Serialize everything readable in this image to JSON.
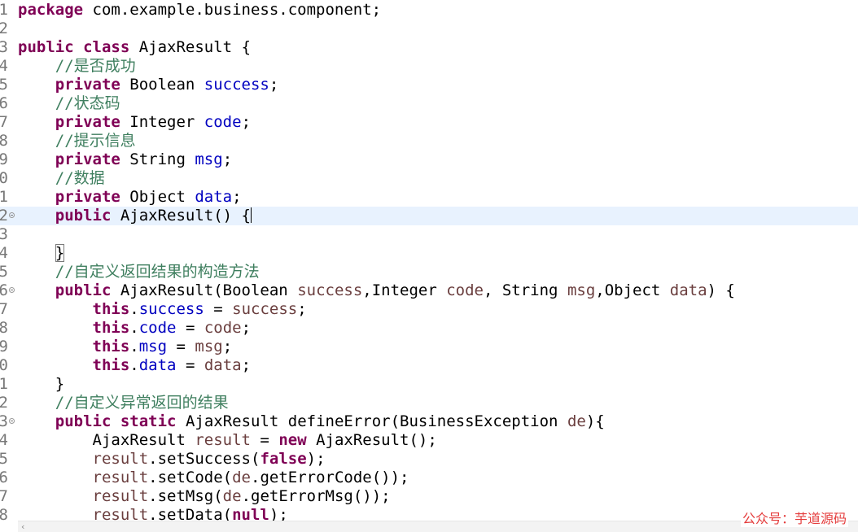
{
  "editor": {
    "lines": [
      {
        "number": "1",
        "fold": false,
        "current": false,
        "tokens": [
          {
            "t": "kw",
            "v": "package"
          },
          {
            "t": "",
            "v": " com.example.business.component;"
          }
        ]
      },
      {
        "number": "2",
        "fold": false,
        "current": false,
        "tokens": []
      },
      {
        "number": "3",
        "fold": false,
        "current": false,
        "tokens": [
          {
            "t": "kw",
            "v": "public"
          },
          {
            "t": "",
            "v": " "
          },
          {
            "t": "kw",
            "v": "class"
          },
          {
            "t": "",
            "v": " AjaxResult {"
          }
        ]
      },
      {
        "number": "4",
        "fold": false,
        "current": false,
        "tokens": [
          {
            "t": "",
            "v": "    "
          },
          {
            "t": "cm",
            "v": "//是否成功"
          }
        ]
      },
      {
        "number": "5",
        "fold": false,
        "current": false,
        "tokens": [
          {
            "t": "",
            "v": "    "
          },
          {
            "t": "kw",
            "v": "private"
          },
          {
            "t": "",
            "v": " Boolean "
          },
          {
            "t": "fld",
            "v": "success"
          },
          {
            "t": "",
            "v": ";"
          }
        ]
      },
      {
        "number": "6",
        "fold": false,
        "current": false,
        "tokens": [
          {
            "t": "",
            "v": "    "
          },
          {
            "t": "cm",
            "v": "//状态码"
          }
        ]
      },
      {
        "number": "7",
        "fold": false,
        "current": false,
        "tokens": [
          {
            "t": "",
            "v": "    "
          },
          {
            "t": "kw",
            "v": "private"
          },
          {
            "t": "",
            "v": " Integer "
          },
          {
            "t": "fld",
            "v": "code"
          },
          {
            "t": "",
            "v": ";"
          }
        ]
      },
      {
        "number": "8",
        "fold": false,
        "current": false,
        "tokens": [
          {
            "t": "",
            "v": "    "
          },
          {
            "t": "cm",
            "v": "//提示信息"
          }
        ]
      },
      {
        "number": "9",
        "fold": false,
        "current": false,
        "tokens": [
          {
            "t": "",
            "v": "    "
          },
          {
            "t": "kw",
            "v": "private"
          },
          {
            "t": "",
            "v": " String "
          },
          {
            "t": "fld",
            "v": "msg"
          },
          {
            "t": "",
            "v": ";"
          }
        ]
      },
      {
        "number": "0",
        "fold": false,
        "current": false,
        "tokens": [
          {
            "t": "",
            "v": "    "
          },
          {
            "t": "cm",
            "v": "//数据"
          }
        ]
      },
      {
        "number": "1",
        "fold": false,
        "current": false,
        "tokens": [
          {
            "t": "",
            "v": "    "
          },
          {
            "t": "kw",
            "v": "private"
          },
          {
            "t": "",
            "v": " Object "
          },
          {
            "t": "fld",
            "v": "data"
          },
          {
            "t": "",
            "v": ";"
          }
        ]
      },
      {
        "number": "2",
        "fold": true,
        "current": true,
        "tokens": [
          {
            "t": "",
            "v": "    "
          },
          {
            "t": "kw",
            "v": "public"
          },
          {
            "t": "",
            "v": " AjaxResult() {"
          },
          {
            "t": "caret",
            "v": ""
          }
        ]
      },
      {
        "number": "3",
        "fold": false,
        "current": false,
        "tokens": []
      },
      {
        "number": "4",
        "fold": false,
        "current": false,
        "tokens": [
          {
            "t": "",
            "v": "    "
          },
          {
            "t": "boxed",
            "v": "}"
          }
        ]
      },
      {
        "number": "5",
        "fold": false,
        "current": false,
        "tokens": [
          {
            "t": "",
            "v": "    "
          },
          {
            "t": "cm",
            "v": "//自定义返回结果的构造方法"
          }
        ]
      },
      {
        "number": "6",
        "fold": true,
        "current": false,
        "tokens": [
          {
            "t": "",
            "v": "    "
          },
          {
            "t": "kw",
            "v": "public"
          },
          {
            "t": "",
            "v": " AjaxResult(Boolean "
          },
          {
            "t": "pn",
            "v": "success"
          },
          {
            "t": "",
            "v": ",Integer "
          },
          {
            "t": "pn",
            "v": "code"
          },
          {
            "t": "",
            "v": ", String "
          },
          {
            "t": "pn",
            "v": "msg"
          },
          {
            "t": "",
            "v": ",Object "
          },
          {
            "t": "pn",
            "v": "data"
          },
          {
            "t": "",
            "v": ") {"
          }
        ]
      },
      {
        "number": "7",
        "fold": false,
        "current": false,
        "tokens": [
          {
            "t": "",
            "v": "        "
          },
          {
            "t": "kw",
            "v": "this"
          },
          {
            "t": "",
            "v": "."
          },
          {
            "t": "fld",
            "v": "success"
          },
          {
            "t": "",
            "v": " = "
          },
          {
            "t": "pn",
            "v": "success"
          },
          {
            "t": "",
            "v": ";"
          }
        ]
      },
      {
        "number": "8",
        "fold": false,
        "current": false,
        "tokens": [
          {
            "t": "",
            "v": "        "
          },
          {
            "t": "kw",
            "v": "this"
          },
          {
            "t": "",
            "v": "."
          },
          {
            "t": "fld",
            "v": "code"
          },
          {
            "t": "",
            "v": " = "
          },
          {
            "t": "pn",
            "v": "code"
          },
          {
            "t": "",
            "v": ";"
          }
        ]
      },
      {
        "number": "9",
        "fold": false,
        "current": false,
        "tokens": [
          {
            "t": "",
            "v": "        "
          },
          {
            "t": "kw",
            "v": "this"
          },
          {
            "t": "",
            "v": "."
          },
          {
            "t": "fld",
            "v": "msg"
          },
          {
            "t": "",
            "v": " = "
          },
          {
            "t": "pn",
            "v": "msg"
          },
          {
            "t": "",
            "v": ";"
          }
        ]
      },
      {
        "number": "0",
        "fold": false,
        "current": false,
        "tokens": [
          {
            "t": "",
            "v": "        "
          },
          {
            "t": "kw",
            "v": "this"
          },
          {
            "t": "",
            "v": "."
          },
          {
            "t": "fld",
            "v": "data"
          },
          {
            "t": "",
            "v": " = "
          },
          {
            "t": "pn",
            "v": "data"
          },
          {
            "t": "",
            "v": ";"
          }
        ]
      },
      {
        "number": "1",
        "fold": false,
        "current": false,
        "tokens": [
          {
            "t": "",
            "v": "    }"
          }
        ]
      },
      {
        "number": "2",
        "fold": false,
        "current": false,
        "tokens": [
          {
            "t": "",
            "v": "    "
          },
          {
            "t": "cm",
            "v": "//自定义异常返回的结果"
          }
        ]
      },
      {
        "number": "3",
        "fold": true,
        "current": false,
        "tokens": [
          {
            "t": "",
            "v": "    "
          },
          {
            "t": "kw",
            "v": "public"
          },
          {
            "t": "",
            "v": " "
          },
          {
            "t": "kw",
            "v": "static"
          },
          {
            "t": "",
            "v": " AjaxResult defineError(BusinessException "
          },
          {
            "t": "pn",
            "v": "de"
          },
          {
            "t": "",
            "v": "){"
          }
        ]
      },
      {
        "number": "4",
        "fold": false,
        "current": false,
        "tokens": [
          {
            "t": "",
            "v": "        AjaxResult "
          },
          {
            "t": "pn",
            "v": "result"
          },
          {
            "t": "",
            "v": " = "
          },
          {
            "t": "kw",
            "v": "new"
          },
          {
            "t": "",
            "v": " AjaxResult();"
          }
        ]
      },
      {
        "number": "5",
        "fold": false,
        "current": false,
        "tokens": [
          {
            "t": "",
            "v": "        "
          },
          {
            "t": "pn",
            "v": "result"
          },
          {
            "t": "",
            "v": ".setSuccess("
          },
          {
            "t": "kw",
            "v": "false"
          },
          {
            "t": "",
            "v": ");"
          }
        ]
      },
      {
        "number": "6",
        "fold": false,
        "current": false,
        "tokens": [
          {
            "t": "",
            "v": "        "
          },
          {
            "t": "pn",
            "v": "result"
          },
          {
            "t": "",
            "v": ".setCode("
          },
          {
            "t": "pn",
            "v": "de"
          },
          {
            "t": "",
            "v": ".getErrorCode());"
          }
        ]
      },
      {
        "number": "7",
        "fold": false,
        "current": false,
        "tokens": [
          {
            "t": "",
            "v": "        "
          },
          {
            "t": "pn",
            "v": "result"
          },
          {
            "t": "",
            "v": ".setMsg("
          },
          {
            "t": "pn",
            "v": "de"
          },
          {
            "t": "",
            "v": ".getErrorMsg());"
          }
        ]
      },
      {
        "number": "8",
        "fold": false,
        "current": false,
        "tokens": [
          {
            "t": "",
            "v": "        "
          },
          {
            "t": "pn",
            "v": "result"
          },
          {
            "t": "",
            "v": ".setData("
          },
          {
            "t": "kw",
            "v": "null"
          },
          {
            "t": "",
            "v": ");"
          }
        ]
      }
    ]
  },
  "scrollbar": {
    "left_arrow": "‹"
  },
  "watermark": {
    "text": "公众号：芋道源码"
  },
  "colors": {
    "keyword": "#7f0055",
    "field": "#0000c0",
    "comment": "#3f7f5f",
    "parameter": "#6a3e3e",
    "current_line": "#e8f2fe",
    "watermark": "#e43b3b"
  }
}
